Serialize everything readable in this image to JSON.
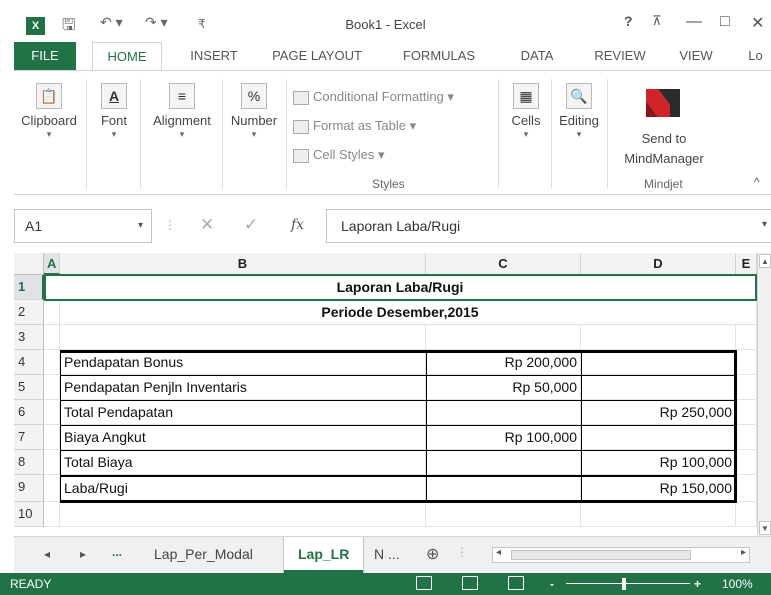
{
  "window": {
    "title": "Book1 - Excel",
    "app_icon": "X",
    "help": "?",
    "minimize": "—",
    "maximize": "□",
    "close": "✕",
    "restore_ribbon": "⊼"
  },
  "quick_access": {
    "save": "🖫",
    "undo": "↶ ▾",
    "redo": "↷ ▾",
    "customize": "₹"
  },
  "tabs": [
    {
      "label": "FILE"
    },
    {
      "label": "HOME"
    },
    {
      "label": "INSERT"
    },
    {
      "label": "PAGE LAYOUT"
    },
    {
      "label": "FORMULAS"
    },
    {
      "label": "DATA"
    },
    {
      "label": "REVIEW"
    },
    {
      "label": "VIEW"
    },
    {
      "label": "Lo"
    }
  ],
  "ribbon": {
    "clipboard": "Clipboard",
    "font": "Font",
    "font_icon": "A",
    "alignment": "Alignment",
    "alignment_icon": "≡",
    "number": "Number",
    "number_icon": "%",
    "styles": {
      "conditional_formatting": "Conditional Formatting ▾",
      "format_as_table": "Format as Table ▾",
      "cell_styles": "Cell Styles ▾",
      "group_label": "Styles"
    },
    "cells": "Cells",
    "editing": "Editing",
    "send_to_line1": "Send to",
    "send_to_line2": "MindManager",
    "mindjet_label": "Mindjet",
    "dropdown_glyph": "▾"
  },
  "formula_bar": {
    "name_box": "A1",
    "cancel": "✕",
    "enter": "✓",
    "fx": "fx",
    "content": "Laporan Laba/Rugi"
  },
  "grid": {
    "columns": [
      "A",
      "B",
      "C",
      "D",
      "E"
    ],
    "rows": [
      "1",
      "2",
      "3",
      "4",
      "5",
      "6",
      "7",
      "8",
      "9",
      "10"
    ],
    "title": "Laporan Laba/Rugi",
    "subtitle": "Periode Desember,2015",
    "table": [
      {
        "label": "Pendapatan Bonus",
        "c": "Rp 200,000",
        "d": ""
      },
      {
        "label": "Pendapatan Penjln Inventaris",
        "c": "Rp 50,000",
        "d": ""
      },
      {
        "label": "Total Pendapatan",
        "c": "",
        "d": "Rp 250,000"
      },
      {
        "label": "Biaya Angkut",
        "c": "Rp 100,000",
        "d": ""
      },
      {
        "label": "Total Biaya",
        "c": "",
        "d": "Rp 100,000"
      },
      {
        "label": "Laba/Rugi",
        "c": "",
        "d": "Rp 150,000"
      }
    ]
  },
  "sheets": {
    "prev": "◂",
    "next": "▸",
    "more_left": "...",
    "tabs": [
      "Lap_Per_Modal",
      "Lap_LR",
      "N ..."
    ],
    "add": "⊕"
  },
  "status": {
    "ready": "READY",
    "zoom": "100%",
    "zoom_minus": "-",
    "zoom_plus": "+"
  },
  "colors": {
    "accent": "#217346",
    "status_bar": "#217346"
  }
}
